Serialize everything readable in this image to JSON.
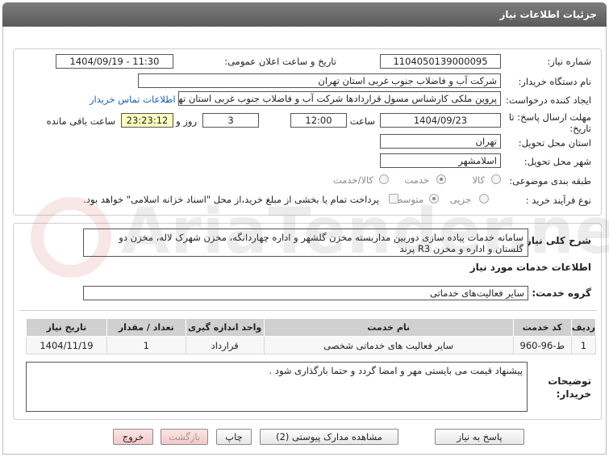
{
  "title": "جزئیات اطلاعات نیاز",
  "fields": {
    "need_number_label": "شماره نیاز:",
    "need_number": "1104050139000095",
    "announce_label": "تاریخ و ساعت اعلان عمومی:",
    "announce_value": "1404/09/19 - 11:30",
    "buyer_org_label": "نام دستگاه خریدار:",
    "buyer_org": "شرکت آب و فاضلاب جنوب غربی استان تهران",
    "creator_label": "ایجاد کننده درخواست:",
    "creator": "پروین  ملکی کارشناس مسول قراردادها  شرکت آب و فاضلاب جنوب غربی استان تهران",
    "contact_link": "اطلاعات تماس خریدار",
    "deadline_label": "مهلت ارسال پاسخ: تا تاریخ:",
    "deadline_date": "1404/09/23",
    "time_label": "ساعت",
    "deadline_time": "12:00",
    "days_value": "3",
    "days_label": "روز و",
    "remaining_time": "23:23:12",
    "remaining_label": "ساعت باقی مانده",
    "province_label": "استان محل تحویل:",
    "province": "تهران",
    "city_label": "شهر محل تحویل:",
    "city": "اسلامشهر",
    "category_label": "طبقه بندی موضوعی:",
    "category_options": [
      "کالا",
      "خدمت",
      "کالا/خدمت"
    ],
    "purchase_type_label": "نوع فرآیند خرید :",
    "purchase_type_options": [
      "جزیی",
      "متوسط"
    ],
    "treasury_note": "پرداخت تمام یا بخشی از مبلغ خرید،از محل \"اسناد خزانه اسلامی\" خواهد بود."
  },
  "description": {
    "label": "شرح کلی نیاز:",
    "text": "سامانه خدمات پیاده سازی دوربین مداربسته مخزن گلشهر و اداره چهاردانگه، مخزن شهرک لاله، مخزن دو گلستان و اداره و مخزن R3 پرند"
  },
  "services": {
    "section_title": "اطلاعات خدمات مورد نیاز",
    "group_label": "گروه خدمت:",
    "group_value": "سایر فعالیت‌های خدماتی",
    "columns": [
      "ردیف",
      "کد خدمت",
      "نام خدمت",
      "واحد اندازه گیری",
      "تعداد / مقدار",
      "تاریخ نیاز"
    ],
    "rows": [
      [
        "1",
        "ط-96-960",
        "سایر فعالیت های خدماتی شخصی",
        "قرارداد",
        "1",
        "1404/11/19"
      ]
    ]
  },
  "buyer_notes": {
    "label": "توضیحات خریدار:",
    "text": "پیشنهاد قیمت می بایستی مهر و امضا گردد و حتما بارگذاری شود ."
  },
  "buttons": {
    "reply": "پاسخ به نیاز",
    "view_docs": "مشاهده مدارک پیوستی (2)",
    "print": "چاپ",
    "back": "بازگشت",
    "exit": "خروج"
  },
  "watermark": "AriaTender.net"
}
